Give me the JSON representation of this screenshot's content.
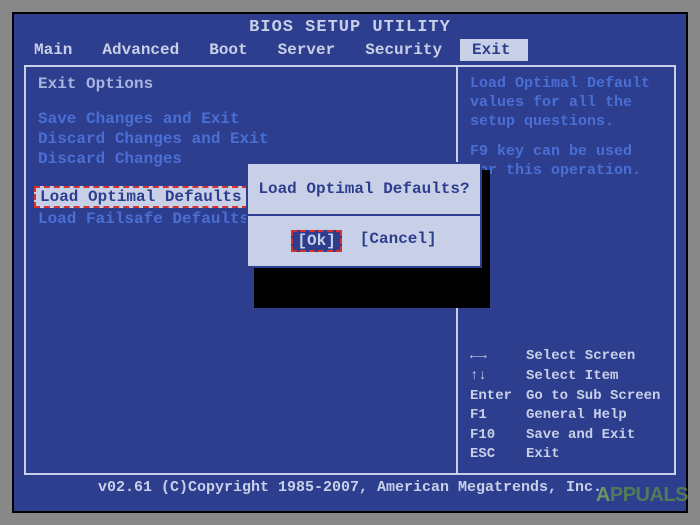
{
  "title": "BIOS SETUP UTILITY",
  "menu": {
    "items": [
      {
        "label": "Main"
      },
      {
        "label": "Advanced"
      },
      {
        "label": "Boot"
      },
      {
        "label": "Server"
      },
      {
        "label": "Security"
      },
      {
        "label": "Exit"
      }
    ],
    "active": 5
  },
  "section_title": "Exit Options",
  "options": [
    {
      "label": "Save Changes and Exit"
    },
    {
      "label": "Discard Changes and Exit"
    },
    {
      "label": "Discard Changes"
    },
    {
      "label": "Load Optimal Defaults"
    },
    {
      "label": "Load Failsafe Defaults"
    }
  ],
  "selected_option": 3,
  "help": {
    "line1": "Load Optimal Default values for all the setup questions.",
    "line2": "F9 key can be used for this operation."
  },
  "nav": {
    "rows": [
      {
        "key": "←→",
        "desc": "Select Screen"
      },
      {
        "key": "↑↓",
        "desc": "Select Item"
      },
      {
        "key": "Enter",
        "desc": "Go to Sub Screen"
      },
      {
        "key": "F1",
        "desc": "General Help"
      },
      {
        "key": "F10",
        "desc": "Save and Exit"
      },
      {
        "key": "ESC",
        "desc": "Exit"
      }
    ]
  },
  "dialog": {
    "title": "Load Optimal Defaults?",
    "ok": "[Ok]",
    "cancel": "[Cancel]"
  },
  "footer": "v02.61 (C)Copyright 1985-2007, American Megatrends, Inc.",
  "watermark": "APPUALS"
}
